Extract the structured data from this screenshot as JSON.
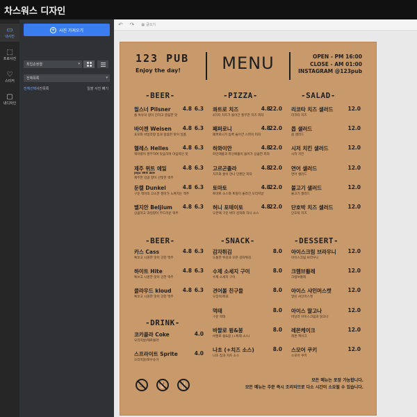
{
  "app": {
    "title": "차스워스 디자인",
    "logo_glyph": "S"
  },
  "rail": [
    {
      "label": "내사진",
      "icon": "photo-icon",
      "glyph": "▭",
      "active": true
    },
    {
      "label": "프로사진",
      "icon": "pro-photo-icon",
      "glyph": "⬚"
    },
    {
      "label": "스티커",
      "icon": "heart-icon",
      "glyph": "♡"
    },
    {
      "label": "내디자인",
      "icon": "design-icon",
      "glyph": "▢"
    }
  ],
  "panel": {
    "import_button": "사진 가져오기",
    "sort_value": "최입순정렬",
    "filter_value": "전체목록",
    "all_link": "전체선택",
    "photo_label": "사진목록",
    "remove_link": "일괄 사진 빼기"
  },
  "toolbar": {
    "undo": "↶",
    "redo": "↷",
    "grid_label": "글쓰기"
  },
  "menu": {
    "title_pub": "123 PUB",
    "tagline": "Enjoy the day!",
    "title_menu": "MENU",
    "info": [
      "OPEN - PM 16:00",
      "CLOSE - AM 01:00",
      "INSTAGRAM @123pub"
    ],
    "sections": {
      "beer": "-BEER-",
      "pizza": "-PIZZA-",
      "salad": "-SALAD-",
      "beer2": "-BEER-",
      "snack": "-SNACK-",
      "dessert": "-DESSERT-",
      "drink": "-DRINK-"
    },
    "col1": [
      {
        "name": "필스너 Pilsner",
        "desc": "홉 특유의 향이 진하고 깔끔한 맛",
        "p1": "4.8",
        "p2": "6.3"
      },
      {
        "name": "바이젠 Weisen",
        "desc": "효모와 바닐라향 등과 달콤한 맛이 일품",
        "p1": "4.8",
        "p2": "6.3"
      },
      {
        "name": "헬레스 Helles",
        "desc": "맥아향이 풍부하여 맛음하며 마음적인 맛",
        "p1": "4.8",
        "p2": "6.3"
      },
      {
        "name": "제주 위트 에일",
        "sub": "Jeju Wit Ale",
        "desc": "제주한 감귤 향이 산뜻한 맥주",
        "p1": "4.8",
        "p2": "6.3"
      },
      {
        "name": "둔켈 Dunkel",
        "desc": "구운 맥아의 고소한 풍미가 느껴지는 맥주",
        "p1": "4.8",
        "p2": "6.3"
      },
      {
        "name": "벨지안 Beljium",
        "desc": "상큼하고 과일향이 부드러운 맥주",
        "p1": "4.8",
        "p2": "6.3"
      }
    ],
    "col1b": [
      {
        "name": "카스 Cass",
        "desc": "톡쏘고 시원한 맛이 강한 맥주",
        "p1": "4.8",
        "p2": "6.3"
      },
      {
        "name": "하이트 Hite",
        "desc": "톡쏘고 시원한 맛이 강한 맥주",
        "p1": "4.8",
        "p2": "6.3"
      },
      {
        "name": "클라우드 kloud",
        "desc": "톡쏘고 시원한 맛이 강한 맥주",
        "p1": "4.8",
        "p2": "6.3"
      }
    ],
    "col1c": [
      {
        "name": "코카콜라 Coke",
        "desc": "오리지날/제로콜라",
        "p2": "4.0"
      },
      {
        "name": "스프라이트 Sprite",
        "desc": "오리지날/로우슈거",
        "p2": "4.0"
      }
    ],
    "col2": [
      {
        "name": "콰트로 치즈",
        "desc": "4가지 치즈가 들어간 풍부한 치즈 피자",
        "p1": "4.8",
        "p2": "22.0"
      },
      {
        "name": "페퍼로니",
        "desc": "페퍼로니가 듬뿍 들어간 스파이 피자",
        "p1": "4.8",
        "p2": "22.0"
      },
      {
        "name": "하와이안",
        "desc": "파인애플과 파인애플이 들어가 상큼한 피자",
        "p1": "4.8",
        "p2": "22.0"
      },
      {
        "name": "고르곤졸라",
        "desc": "치즈와 꿀이 만나 단짠단 피자",
        "p1": "4.8",
        "p2": "22.0"
      },
      {
        "name": "토마토",
        "desc": "토마토 소스와 토핑이 올라간 오리지날",
        "p1": "4.8",
        "p2": "22.0"
      },
      {
        "name": "허니 포테이토",
        "desc": "오븐에 구운 버터 감자와 허니 소스",
        "p1": "4.8",
        "p2": "22.0"
      }
    ],
    "col2b": [
      {
        "name": "감자튀김",
        "desc": "도톰한 튀김과 오븐 감자튀김",
        "p2": "8.0"
      },
      {
        "name": "수제 소세지 구이",
        "desc": "수제 소세지 구이",
        "p2": "8.0"
      },
      {
        "name": "견어볼 친구들",
        "desc": "오징어/쥐포",
        "p2": "8.0"
      },
      {
        "name": "먹태",
        "desc": "구운 먹태",
        "p2": "8.0"
      },
      {
        "name": "바팔로 윙&봉",
        "desc": "바팔로 윙&봉 (+특제 소스)",
        "p2": "8.0"
      },
      {
        "name": "나초 (+치즈 소스)",
        "desc": "나초 칩과 치즈 소스",
        "p2": "8.0"
      }
    ],
    "col3": [
      {
        "name": "리코타 치즈 샐러드",
        "desc": "리코타 치즈",
        "p2": "12.0"
      },
      {
        "name": "콥 샐러드",
        "desc": "콥 샐러드",
        "p2": "12.0"
      },
      {
        "name": "시저 치킨 샐러드",
        "desc": "시저 치킨",
        "p2": "12.0"
      },
      {
        "name": "연어 샐러드",
        "desc": "연어 샐러드",
        "p2": "12.0"
      },
      {
        "name": "불고기 샐러드",
        "desc": "불고기 샐러드",
        "p2": "12.0"
      },
      {
        "name": "단호박 치즈 샐러드",
        "desc": "단호박 치즈",
        "p2": "12.0"
      }
    ],
    "col3b": [
      {
        "name": "아이스크림 브라우니",
        "desc": "아이스크림 브라우니",
        "p2": "12.0"
      },
      {
        "name": "크렘브륄레",
        "desc": "크렘브륄레",
        "p2": "12.0"
      },
      {
        "name": "아이스 샤인머스캣",
        "desc": "얼린 샤인머스캣",
        "p2": "12.0"
      },
      {
        "name": "아이스 딸고나",
        "desc": "바닐라 아이스크림과 달고나",
        "p2": "12.0"
      },
      {
        "name": "레몬케이크",
        "desc": "레몬 케이크",
        "p2": "12.0"
      },
      {
        "name": "스모어 쿠키",
        "desc": "스모어 쿠키",
        "p2": "12.0"
      }
    ],
    "footer": [
      "모든 메뉴는 포장 가능합니다.",
      "모든 메뉴는 주문 즉시 조리되므로 다소 시간이 소요될 수 있습니다."
    ],
    "no_icons": [
      "no-smoking-icon",
      "no-pets-icon",
      "no-outside-food-icon"
    ],
    "no_glyphs": [
      "♨",
      "🐕",
      "🍴"
    ]
  }
}
